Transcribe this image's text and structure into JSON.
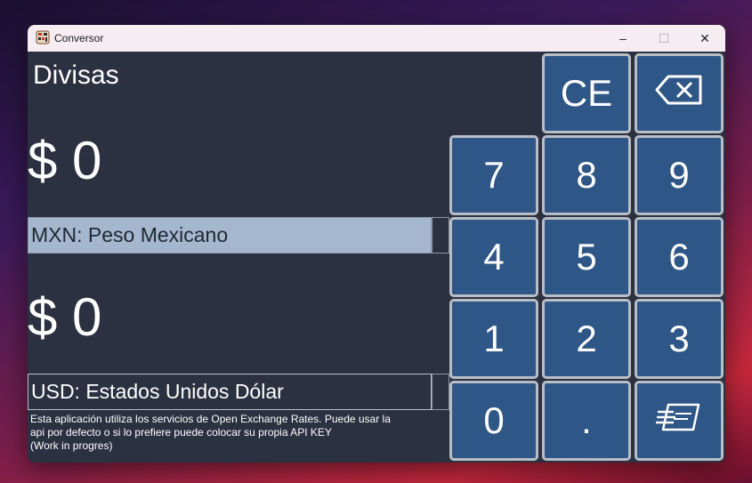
{
  "window": {
    "title": "Conversor",
    "controls": {
      "minimize": "–",
      "maximize": "☐",
      "close": "✕"
    }
  },
  "app": {
    "heading": "Divisas",
    "from_amount": "$ 0",
    "from_currency": "MXN: Peso Mexicano",
    "to_amount": "$ 0",
    "to_currency": "USD: Estados Unidos Dólar",
    "note_line1": "Esta aplicación utiliza los servicios de Open Exchange Rates. Puede usar la",
    "note_line2": "api por defecto o si lo prefiere puede colocar su propia API KEY",
    "note_line3": "(Work in progres)"
  },
  "keypad": {
    "ce": "CE",
    "backspace": "⌫",
    "k7": "7",
    "k8": "8",
    "k9": "9",
    "k4": "4",
    "k5": "5",
    "k6": "6",
    "k1": "1",
    "k2": "2",
    "k3": "3",
    "k0": "0",
    "dot": ".",
    "api_key_icon": "api-key-card-icon"
  }
}
